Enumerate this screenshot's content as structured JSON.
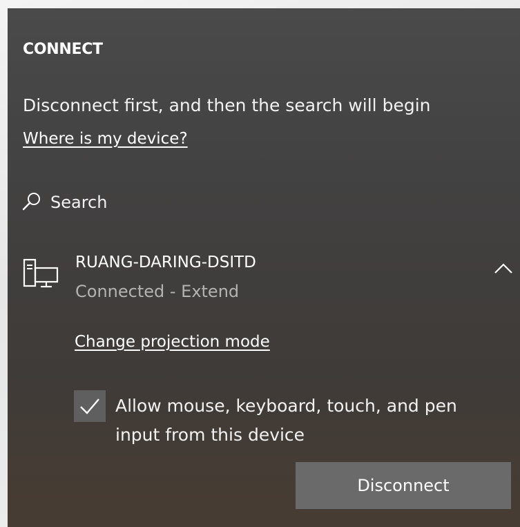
{
  "panel": {
    "title": "CONNECT",
    "status_message": "Disconnect first, and then the search will begin",
    "where_link": "Where is my device?",
    "search_label": "Search"
  },
  "device": {
    "name": "RUANG-DARING-DSITD",
    "status": "Connected - Extend",
    "icon": "projector-display-icon",
    "expanded": true
  },
  "options": {
    "projection_link": "Change projection mode",
    "allow_input_label": "Allow mouse, keyboard, touch, and pen input from this device",
    "allow_input_checked": true
  },
  "actions": {
    "disconnect_label": "Disconnect"
  },
  "colors": {
    "panel_background": "#444242",
    "text_primary": "#ffffff",
    "text_secondary": "#b3b3b3",
    "button_background": "#6a6a6a",
    "checkbox_background": "#5f5f5f"
  }
}
